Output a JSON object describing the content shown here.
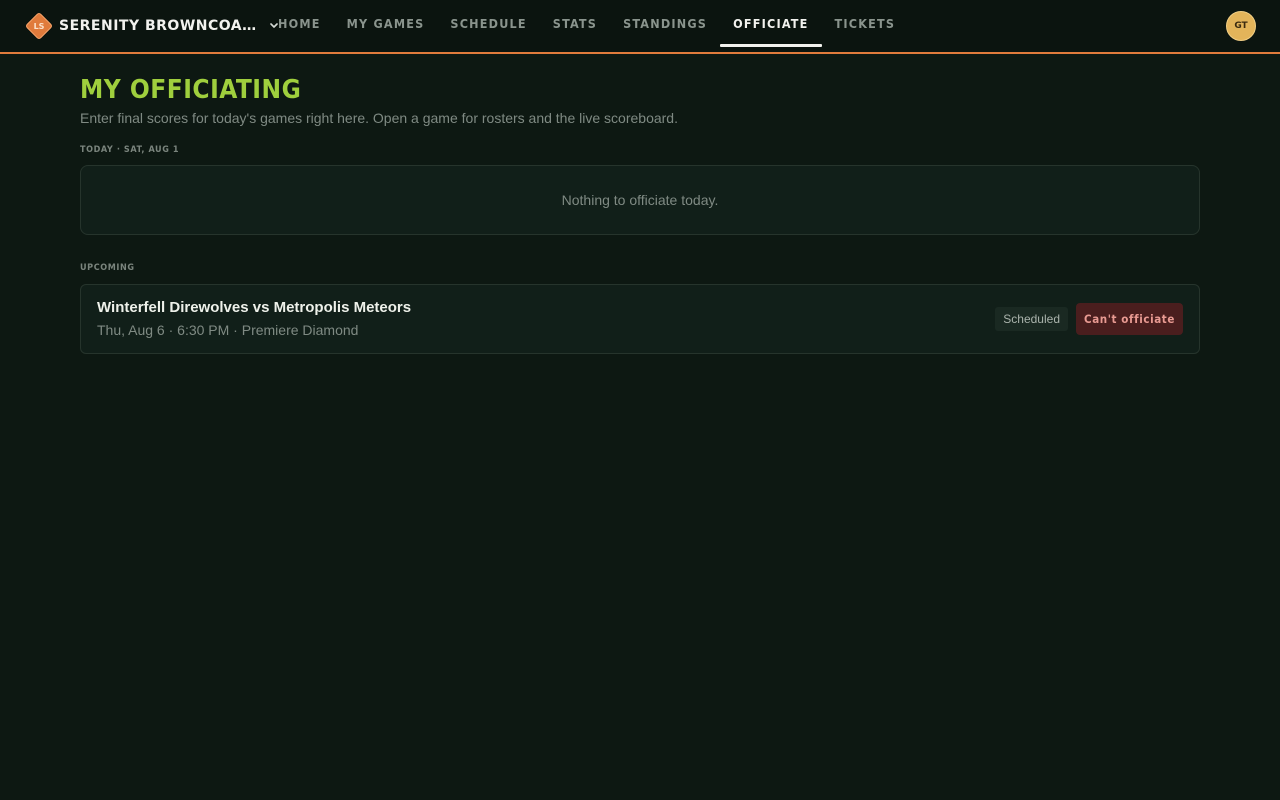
{
  "brand": {
    "initials": "LS",
    "name": "SERENITY BROWNCOA…"
  },
  "nav": {
    "items": [
      {
        "label": "HOME"
      },
      {
        "label": "MY GAMES"
      },
      {
        "label": "SCHEDULE"
      },
      {
        "label": "STATS"
      },
      {
        "label": "STANDINGS"
      },
      {
        "label": "OFFICIATE",
        "active": true
      },
      {
        "label": "TICKETS"
      }
    ]
  },
  "user": {
    "initials": "GT"
  },
  "page": {
    "title": "MY OFFICIATING",
    "subtitle": "Enter final scores for today's games right here. Open a game for rosters and the live scoreboard."
  },
  "today": {
    "label": "TODAY · SAT, AUG 1",
    "empty_message": "Nothing to officiate today."
  },
  "upcoming": {
    "label": "UPCOMING",
    "games": [
      {
        "title": "Winterfell Direwolves vs Metropolis Meteors",
        "meta": "Thu, Aug 6 · 6:30 PM · Premiere Diamond",
        "status": "Scheduled",
        "action_label": "Can't officiate"
      }
    ]
  },
  "colors": {
    "accent": "#e07b3c",
    "title": "#9fcf3d",
    "background": "#0d1812",
    "danger_button": "#4a1e1e"
  },
  "icons": {
    "brand_chevron": "chevron-down-icon"
  }
}
